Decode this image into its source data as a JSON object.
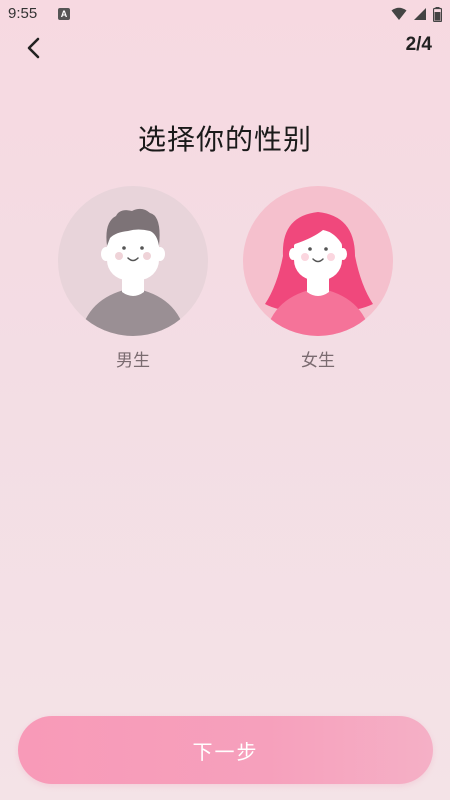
{
  "status_bar": {
    "time": "9:55",
    "notification_letter": "A"
  },
  "header": {
    "step": "2/4"
  },
  "title": "选择你的性别",
  "options": [
    {
      "label": "男生"
    },
    {
      "label": "女生"
    }
  ],
  "next_button": {
    "label": "下一步"
  },
  "colors": {
    "accent": "#f89ab8",
    "female_avatar_bg": "#f5c0cd",
    "male_avatar_bg": "#e8d4da",
    "female_hair": "#f0487c",
    "male_body": "#9a8f94"
  }
}
